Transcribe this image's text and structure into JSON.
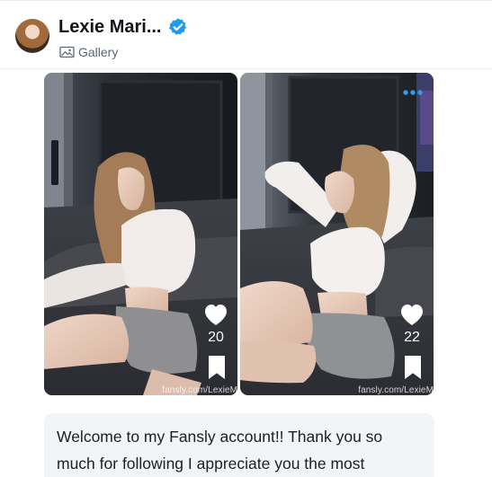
{
  "header": {
    "name": "Lexie Mari...",
    "verified": true,
    "sub_label": "Gallery"
  },
  "media": [
    {
      "likes": "20",
      "watermark": "fansly.com/LexieM"
    },
    {
      "likes": "22",
      "watermark": "fansly.com/LexieM"
    }
  ],
  "caption": {
    "text": "Welcome to my Fansly account!! Thank you so much for following I appreciate you the most"
  },
  "colors": {
    "verified_blue": "#1d9bf0",
    "more_dots": "#2f9bf0",
    "caption_bg": "#f2f4f6"
  },
  "icons": {
    "verified": "verified-badge-icon",
    "gallery": "gallery-icon",
    "heart": "heart-icon",
    "bookmark": "bookmark-icon",
    "more": "more-dots-icon"
  }
}
